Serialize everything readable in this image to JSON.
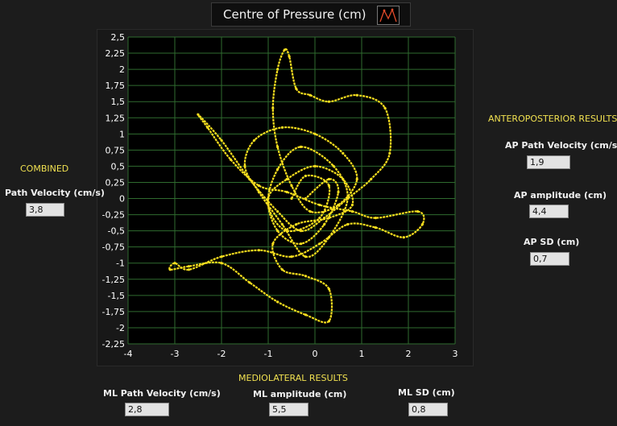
{
  "chart_title": "Centre of Pressure (cm)",
  "colors": {
    "trace": "#f7de1e",
    "grid": "#2f6b2f",
    "plot_bg": "#000000"
  },
  "chart_data": {
    "type": "line",
    "title": "Centre of Pressure (cm)",
    "xlabel": "",
    "ylabel": "",
    "xlim": [
      -4,
      3
    ],
    "ylim": [
      -2.25,
      2.5
    ],
    "x_ticks": [
      -4,
      -3,
      -2,
      -1,
      0,
      1,
      2,
      3
    ],
    "x_tick_labels": [
      "-4",
      "-3",
      "-2",
      "-1",
      "0",
      "1",
      "2",
      "3"
    ],
    "y_ticks": [
      2.5,
      2.25,
      2,
      1.75,
      1.5,
      1.25,
      1,
      0.75,
      0.5,
      0.25,
      0,
      -0.25,
      -0.5,
      -0.75,
      -1,
      -1.25,
      -1.5,
      -1.75,
      -2,
      -2.25
    ],
    "y_tick_labels": [
      "2,5",
      "2,25",
      "2",
      "1,75",
      "1,5",
      "1,25",
      "1",
      "0,75",
      "0,5",
      "0,25",
      "0",
      "-0,25",
      "-0,5",
      "-0,75",
      "-1",
      "-1,25",
      "-1,5",
      "-1,75",
      "-2",
      "-2,25"
    ],
    "grid": true,
    "series": [
      {
        "x": [
          -0.5,
          -0.2,
          0.3,
          0.1,
          -0.6,
          -1.0,
          -0.8,
          -0.3,
          0.4,
          0.7,
          0.3,
          -0.2,
          -0.7,
          -1.2,
          -1.5,
          -1.3,
          -0.7,
          0.0,
          0.6,
          0.9,
          0.5,
          -0.1,
          -0.5,
          -0.8,
          -0.9,
          -0.8,
          -0.65,
          -0.55,
          -0.4,
          -0.1,
          0.3,
          0.9,
          1.5,
          1.6,
          1.2,
          0.7,
          0.2,
          -0.3,
          -0.8,
          -1.4,
          -2.0,
          -2.5,
          -2.3,
          -1.8,
          -1.2,
          -0.6,
          0.1,
          0.8,
          1.3,
          2.2,
          2.3,
          1.9,
          1.3,
          0.7,
          0.1,
          -0.5,
          -1.2,
          -2.0,
          -2.7,
          -3.0,
          -3.1,
          -2.7,
          -2.0,
          -1.4,
          -0.8,
          -0.2,
          0.3,
          0.3,
          -0.2,
          -0.7,
          -0.9,
          -0.4,
          0.3,
          0.8,
          0.6,
          0.0,
          -0.6,
          -1.0,
          -0.8,
          -0.3,
          0.2,
          0.5,
          0.3,
          -0.2
        ],
        "y": [
          0.0,
          0.35,
          0.2,
          -0.3,
          -0.5,
          -0.1,
          0.45,
          0.8,
          0.5,
          0.0,
          -0.6,
          -0.9,
          -0.4,
          0.1,
          0.5,
          0.9,
          1.1,
          1.0,
          0.7,
          0.3,
          -0.1,
          -0.2,
          0.2,
          0.8,
          1.4,
          2.0,
          2.3,
          2.2,
          1.7,
          1.6,
          1.5,
          1.6,
          1.4,
          0.7,
          0.3,
          0.0,
          -0.3,
          -0.5,
          -0.2,
          0.3,
          0.9,
          1.3,
          1.1,
          0.6,
          0.2,
          0.1,
          -0.1,
          -0.2,
          -0.3,
          -0.2,
          -0.4,
          -0.6,
          -0.45,
          -0.4,
          -0.7,
          -0.9,
          -0.8,
          -0.9,
          -1.1,
          -1.0,
          -1.1,
          -1.05,
          -1.0,
          -1.3,
          -1.6,
          -1.8,
          -1.9,
          -1.4,
          -1.2,
          -1.1,
          -0.7,
          -0.4,
          -0.3,
          -0.1,
          0.3,
          0.5,
          0.3,
          0.0,
          -0.5,
          -0.7,
          -0.4,
          0.1,
          0.3,
          0.0
        ]
      }
    ]
  },
  "combined": {
    "heading": "COMBINED",
    "path_velocity_label": "Path Velocity (cm/s)",
    "path_velocity_value": "3,8"
  },
  "anteroposterior": {
    "heading": "ANTEROPOSTERIOR RESULTS",
    "path_velocity_label": "AP Path Velocity (cm/s)",
    "path_velocity_value": "1,9",
    "amplitude_label": "AP amplitude (cm)",
    "amplitude_value": "4,4",
    "sd_label": "AP SD (cm)",
    "sd_value": "0,7"
  },
  "mediolateral": {
    "heading": "MEDIOLATERAL RESULTS",
    "path_velocity_label": "ML Path Velocity (cm/s)",
    "path_velocity_value": "2,8",
    "amplitude_label": "ML amplitude (cm)",
    "amplitude_value": "5,5",
    "sd_label": "ML SD (cm)",
    "sd_value": "0,8"
  }
}
